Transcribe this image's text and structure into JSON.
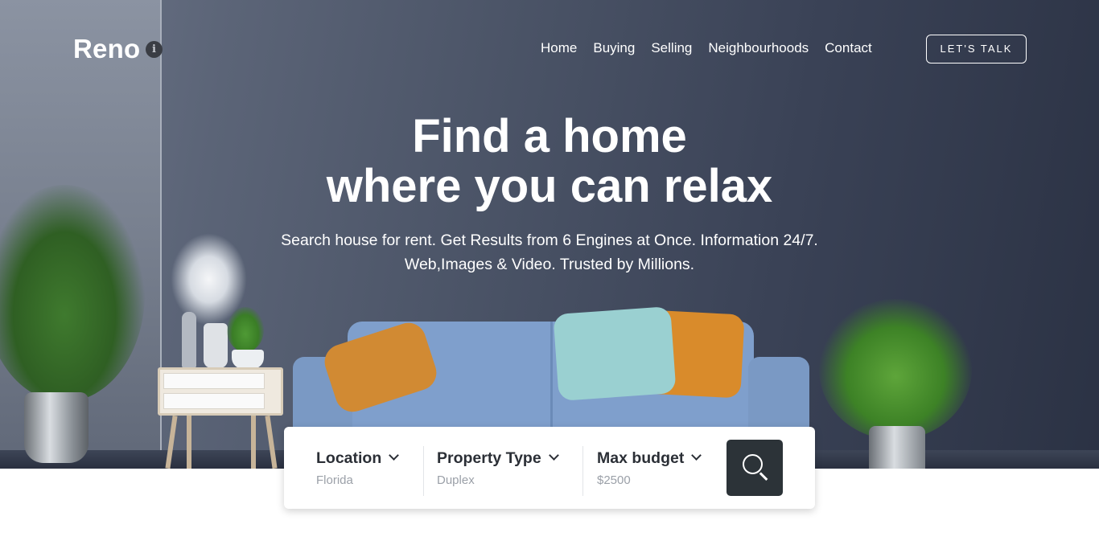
{
  "brand": {
    "name": "Reno",
    "info_glyph": "i"
  },
  "nav": {
    "items": [
      {
        "label": "Home"
      },
      {
        "label": "Buying"
      },
      {
        "label": "Selling"
      },
      {
        "label": "Neighbourhoods"
      },
      {
        "label": "Contact"
      }
    ],
    "cta_label": "LET'S TALK"
  },
  "hero": {
    "title_line1": "Find a home",
    "title_line2": "where you can relax",
    "sub_line1": "Search house for rent. Get Results from 6 Engines at Once. Information 24/7.",
    "sub_line2": "Web,Images & Video. Trusted by Millions."
  },
  "search": {
    "location": {
      "label": "Location",
      "value": "Florida"
    },
    "property_type": {
      "label": "Property Type",
      "value": "Duplex"
    },
    "max_budget": {
      "label": "Max budget",
      "value": "$2500"
    },
    "button_icon": "search-icon"
  },
  "colors": {
    "hero_dark": "#2b3244",
    "search_button": "#2c3338",
    "sofa": "#7f9fcc",
    "pillow_orange": "#d18a33",
    "pillow_teal": "#9ad0d1"
  }
}
